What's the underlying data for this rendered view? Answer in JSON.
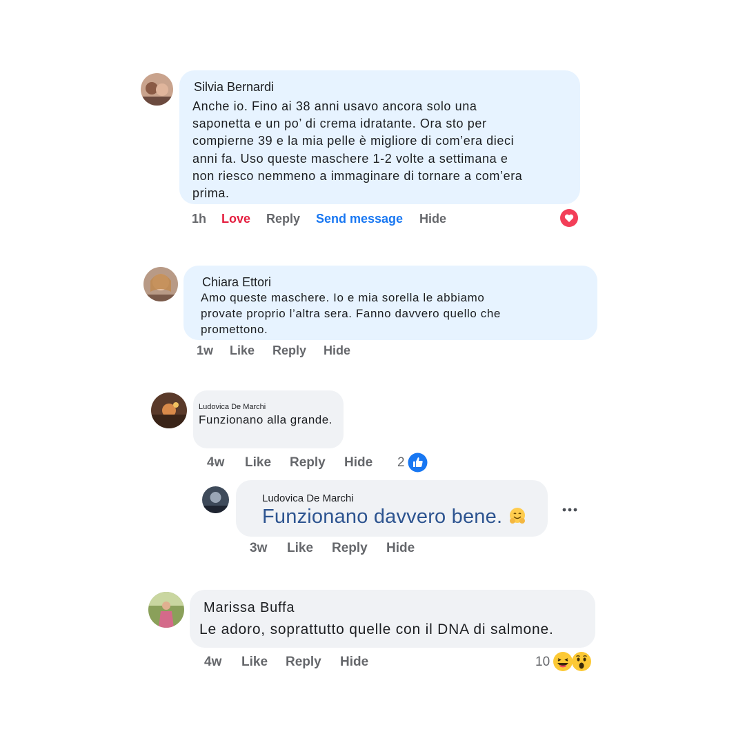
{
  "comments": [
    {
      "author": "Silvia Bernardi",
      "lines": [
        "Anche io. Fino ai 38 anni usavo ancora solo una",
        "saponetta e un po’ di crema idratante. Ora sto per",
        "compierne 39 e la mia pelle è migliore di com’era dieci",
        "anni fa. Uso queste maschere 1-2 volte a settimana e",
        "non riesco nemmeno a immaginare di tornare a com’era",
        "prima."
      ],
      "time": "1h",
      "love": "Love",
      "reply": "Reply",
      "send_message": "Send message",
      "hide": "Hide",
      "reaction_icon": "heart-icon"
    },
    {
      "author": "Chiara Ettori",
      "lines": [
        "Amo queste maschere. Io e mia sorella le abbiamo",
        "provate proprio l’altra sera. Fanno davvero quello che",
        "promettono."
      ],
      "time": "1w",
      "like": "Like",
      "reply": "Reply",
      "hide": "Hide"
    },
    {
      "author": "Ludovica De Marchi",
      "text": "Funzionano alla grande.",
      "time": "4w",
      "like": "Like",
      "reply": "Reply",
      "hide": "Hide",
      "reaction_count": "2",
      "reaction_icon": "thumbs-up-icon"
    },
    {
      "author": "Ludovica De Marchi",
      "text": "Funzionano davvero bene.",
      "emoji": "hugging-face-emoji",
      "time": "3w",
      "like": "Like",
      "reply": "Reply",
      "hide": "Hide",
      "more_icon": "more-options-icon"
    },
    {
      "author": "Marissa Buffa",
      "text": "Le adoro, soprattutto quelle con il DNA di salmone.",
      "time": "4w",
      "like": "Like",
      "reply": "Reply",
      "hide": "Hide",
      "reaction_count": "10",
      "reaction_icons": [
        "laughing-emoji",
        "wow-emoji"
      ]
    }
  ],
  "colors": {
    "blue_bubble": "#e7f3ff",
    "grey_bubble": "#f0f2f5",
    "love_red": "#e41e3f",
    "link_blue": "#1877f2",
    "highlight_text": "#2d5490"
  }
}
